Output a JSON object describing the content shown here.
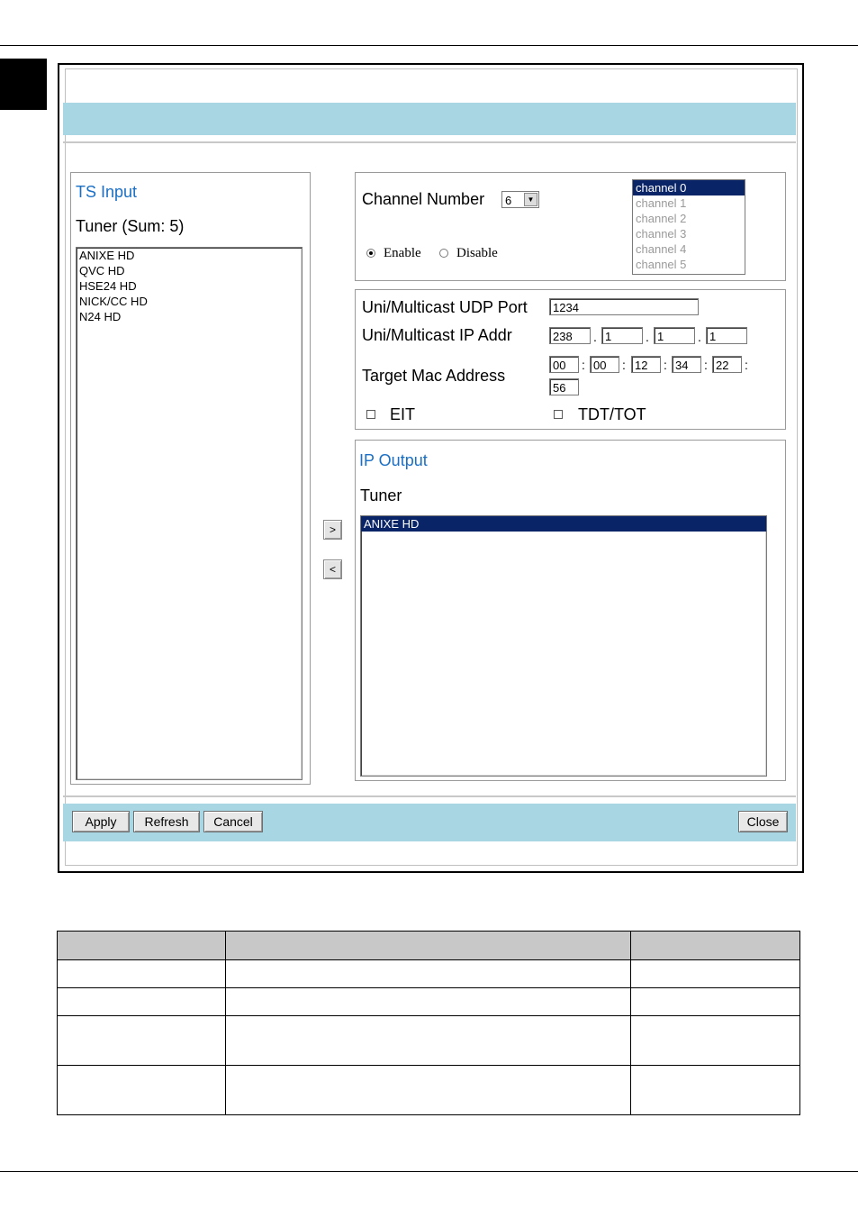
{
  "ts_input": {
    "title": "TS Input",
    "tuner_label": "Tuner (Sum: 5)",
    "items": [
      "ANIXE HD",
      "QVC HD",
      "HSE24 HD",
      "NICK/CC HD",
      "N24 HD"
    ]
  },
  "channel": {
    "label": "Channel Number",
    "selected_value": "6",
    "list": [
      "channel 0",
      "channel 1",
      "channel 2",
      "channel 3",
      "channel 4",
      "channel 5"
    ],
    "enable_label": "Enable",
    "disable_label": "Disable",
    "enabled": true
  },
  "network": {
    "udp_label": "Uni/Multicast UDP Port",
    "udp_value": "1234",
    "ip_label": "Uni/Multicast IP Addr",
    "ip": [
      "238",
      "1",
      "1",
      "1"
    ],
    "mac_label": "Target Mac Address",
    "mac": [
      "00",
      "00",
      "12",
      "34",
      "22",
      "56"
    ],
    "eit_label": "EIT",
    "tdt_label": "TDT/TOT"
  },
  "ip_output": {
    "title": "IP Output",
    "tuner_label": "Tuner",
    "items": [
      "ANIXE HD"
    ]
  },
  "transfer": {
    "add_label": ">",
    "remove_label": "<"
  },
  "footer": {
    "apply_label": "Apply",
    "refresh_label": "Refresh",
    "cancel_label": "Cancel",
    "close_label": "Close"
  },
  "colors": {
    "band": "#a8d7e3",
    "title_blue": "#1a6fc4",
    "selection": "#0a2468"
  }
}
